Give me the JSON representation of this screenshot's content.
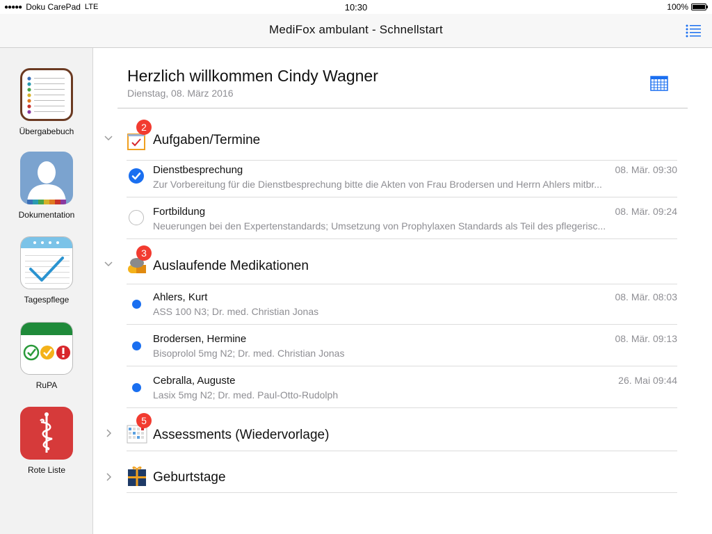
{
  "status_bar": {
    "carrier": "Doku CarePad",
    "network": "LTE",
    "time": "10:30",
    "battery": "100%",
    "battery_level": 1.0
  },
  "nav": {
    "title": "MediFox ambulant - Schnellstart",
    "menu_icon": "list-icon"
  },
  "sidebar": {
    "apps": [
      {
        "label": "Übergabebuch",
        "icon": "notebook-icon"
      },
      {
        "label": "Dokumentation",
        "icon": "person-silhouette-icon"
      },
      {
        "label": "Tagespflege",
        "icon": "checkmark-notepad-icon"
      },
      {
        "label": "RuPA",
        "icon": "status-circles-icon"
      },
      {
        "label": "Rote Liste",
        "icon": "caduceus-icon"
      }
    ]
  },
  "header": {
    "welcome": "Herzlich willkommen Cindy Wagner",
    "date": "Dienstag, 08. März 2016",
    "calendar_icon": "calendar-grid-icon"
  },
  "sections": {
    "tasks": {
      "title": "Aufgaben/Termine",
      "badge": "2",
      "expanded": true,
      "items": [
        {
          "title": "Dienstbesprechung",
          "subtitle": "Zur Vorbereitung für die Dienstbesprechung bitte die Akten von Frau Brodersen und Herrn Ahlers mitbr...",
          "time": "08. Mär. 09:30",
          "done": true
        },
        {
          "title": "Fortbildung",
          "subtitle": "Neuerungen bei den Expertenstandards; Umsetzung von Prophylaxen Standards als Teil des pflegerisc...",
          "time": "08. Mär. 09:24",
          "done": false
        }
      ]
    },
    "medications": {
      "title": "Auslaufende Medikationen",
      "badge": "3",
      "expanded": true,
      "items": [
        {
          "title": "Ahlers, Kurt",
          "subtitle": "ASS 100 N3; Dr. med. Christian Jonas",
          "time": "08. Mär. 08:03"
        },
        {
          "title": "Brodersen, Hermine",
          "subtitle": "Bisoprolol 5mg N2; Dr. med. Christian Jonas",
          "time": "08. Mär. 09:13"
        },
        {
          "title": "Cebralla, Auguste",
          "subtitle": "Lasix 5mg N2; Dr. med. Paul-Otto-Rudolph",
          "time": "26. Mai 09:44"
        }
      ]
    },
    "assessments": {
      "title": "Assessments (Wiedervorlage)",
      "badge": "5",
      "expanded": false
    },
    "birthdays": {
      "title": "Geburtstage",
      "badge": "",
      "expanded": false
    }
  },
  "colors": {
    "accent": "#1a6ff0",
    "badge": "#f23b30",
    "secondary_text": "#8e8e93"
  }
}
